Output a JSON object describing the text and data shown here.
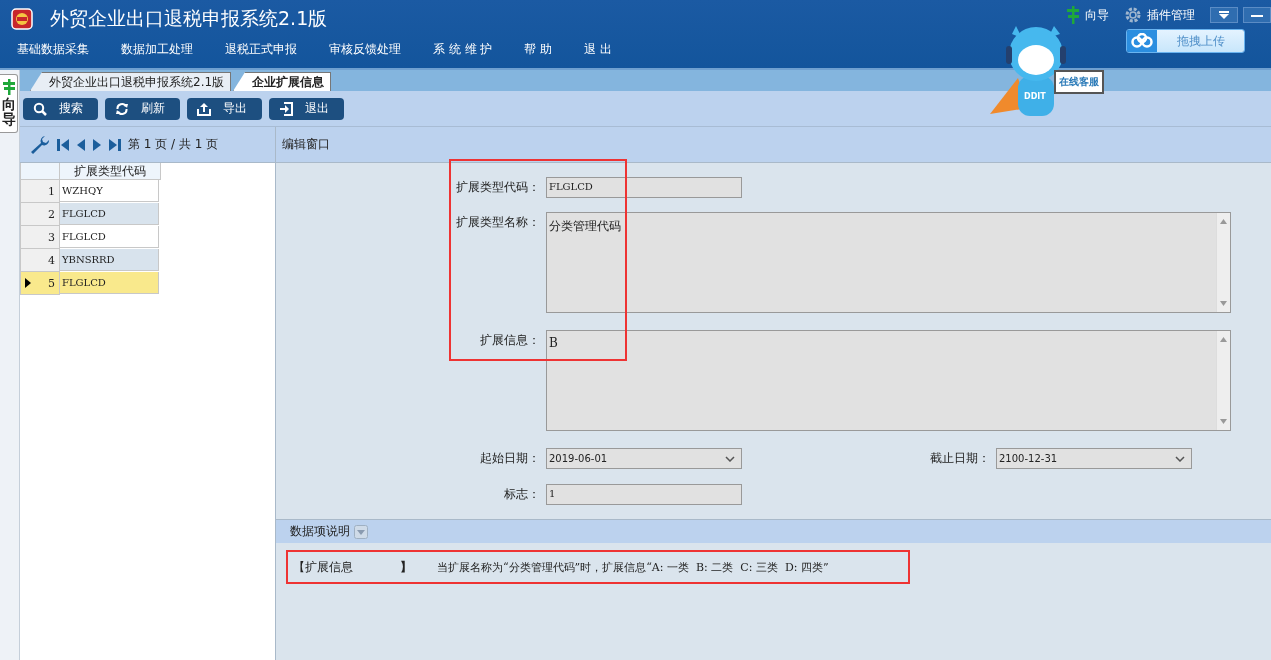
{
  "app": {
    "title": "外贸企业出口退税申报系统2.1版",
    "guide": "向导",
    "plugins": "插件管理",
    "upload": "拖拽上传",
    "menu": [
      "基础数据采集",
      "数据加工处理",
      "退税正式申报",
      "审核反馈处理",
      "系 统 维 护",
      "帮 助",
      "退 出"
    ]
  },
  "mascot": {
    "sign": "在线客服",
    "shirt": "DDIT"
  },
  "side_tab": {
    "label": "向导"
  },
  "tabs": [
    {
      "label": "外贸企业出口退税申报系统2.1版",
      "selected": false
    },
    {
      "label": "企业扩展信息",
      "selected": true
    }
  ],
  "toolbar": [
    {
      "label": "搜索",
      "kind": "search"
    },
    {
      "label": "刷新",
      "kind": "refresh"
    },
    {
      "label": "导出",
      "kind": "export"
    },
    {
      "label": "退出",
      "kind": "exit"
    }
  ],
  "pager": {
    "text": "第 1 页 / 共 1 页"
  },
  "grid": {
    "column": "扩展类型代码",
    "rows": [
      {
        "number": "1",
        "code": "WZHQY",
        "selected": false
      },
      {
        "number": "2",
        "code": "FLGLCD",
        "selected": false
      },
      {
        "number": "3",
        "code": "FLGLCD",
        "selected": false
      },
      {
        "number": "4",
        "code": "YBNSRRD",
        "selected": false
      },
      {
        "number": "5",
        "code": "FLGLCD",
        "selected": true
      }
    ]
  },
  "edit": {
    "title": "编辑窗口",
    "rows": [
      [
        {
          "kind": "text",
          "label": "扩展类型代码：",
          "value": "FLGLCD"
        }
      ],
      [
        {
          "kind": "textarea",
          "label": "扩展类型名称：",
          "value": "分类管理代码"
        }
      ],
      [
        {
          "kind": "textarea",
          "label": "扩展信息：",
          "value": "B"
        }
      ],
      [
        {
          "kind": "select",
          "label": "起始日期：",
          "value": "2019-06-01"
        },
        {
          "kind": "select",
          "label": "截止日期：",
          "value": "2100-12-31"
        }
      ],
      [
        {
          "kind": "text",
          "label": "标志：",
          "value": "1"
        }
      ]
    ]
  },
  "description": {
    "title": "数据项说明",
    "open": "【扩展信息",
    "close": "】",
    "text": "当扩展名称为“分类管理代码”时，扩展信息“A: 一类  B: 二类  C: 三类  D: 四类”"
  }
}
